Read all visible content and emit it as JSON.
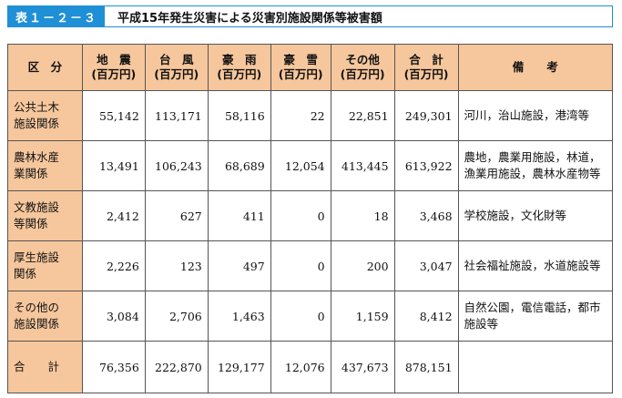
{
  "title": {
    "number": "表１－２－３",
    "text": "平成15年発生災害による災害別施設関係等被害額"
  },
  "table": {
    "headers": [
      {
        "line1": "区　分",
        "line2": ""
      },
      {
        "line1": "地　震",
        "line2": "(百万円)"
      },
      {
        "line1": "台　風",
        "line2": "(百万円)"
      },
      {
        "line1": "豪　雨",
        "line2": "(百万円)"
      },
      {
        "line1": "豪　雪",
        "line2": "(百万円)"
      },
      {
        "line1": "その他",
        "line2": "(百万円)"
      },
      {
        "line1": "合　計",
        "line2": "(百万円)"
      },
      {
        "line1": "備　　考",
        "line2": ""
      }
    ],
    "rows": [
      {
        "label1": "公共土木",
        "label2": "施設関係",
        "values": [
          "55,142",
          "113,171",
          "58,116",
          "22",
          "22,851",
          "249,301"
        ],
        "note1": "河川，治山施設，港湾等",
        "note2": ""
      },
      {
        "label1": "農林水産",
        "label2": "業関係",
        "values": [
          "13,491",
          "106,243",
          "68,689",
          "12,054",
          "413,445",
          "613,922"
        ],
        "note1": "農地，農業用施設，林道，",
        "note2": "漁業用施設，農林水産物等"
      },
      {
        "label1": "文教施設",
        "label2": "等関係",
        "values": [
          "2,412",
          "627",
          "411",
          "0",
          "18",
          "3,468"
        ],
        "note1": "学校施設，文化財等",
        "note2": ""
      },
      {
        "label1": "厚生施設",
        "label2": "関係",
        "values": [
          "2,226",
          "123",
          "497",
          "0",
          "200",
          "3,047"
        ],
        "note1": "社会福祉施設，水道施設等",
        "note2": ""
      },
      {
        "label1": "その他の",
        "label2": "施設関係",
        "values": [
          "3,084",
          "2,706",
          "1,463",
          "0",
          "1,159",
          "8,412"
        ],
        "note1": "自然公園，電信電話，都市",
        "note2": "施設等"
      },
      {
        "label1": "合　　計",
        "label2": "",
        "values": [
          "76,356",
          "222,870",
          "129,177",
          "12,076",
          "437,673",
          "878,151"
        ],
        "note1": "",
        "note2": ""
      }
    ]
  }
}
